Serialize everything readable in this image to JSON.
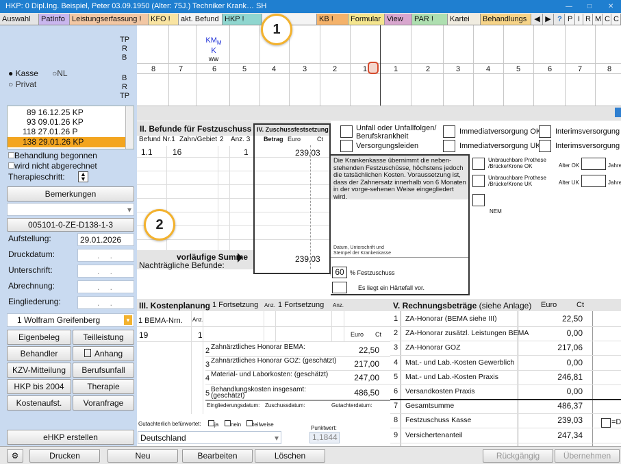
{
  "window": {
    "title": "HKP: 0  Dipl.Ing. Beispiel, Peter  03.09.1950 (Alter: 75J.)  Techniker Krank…  SH"
  },
  "tabs": [
    {
      "label": "Auswahl",
      "color": "#e4e4e4"
    },
    {
      "label": "PatInfo",
      "color": "#c9b6ee"
    },
    {
      "label": "Leistungserfassung !",
      "color": "#f2c7a4"
    },
    {
      "label": "KFO !",
      "color": "#f9e4a2"
    },
    {
      "label": "akt. Befund",
      "color": "#f4f4f4"
    },
    {
      "label": "HKP !",
      "color": "#8fd6cf"
    },
    {
      "label": "…bor",
      "color": "#f4f4f4"
    },
    {
      "label": "KB !",
      "color": "#f4b26a"
    },
    {
      "label": "Formular",
      "color": "#f4e58e"
    },
    {
      "label": "View",
      "color": "#d8a6ce"
    },
    {
      "label": "PAR !",
      "color": "#aedfb0"
    },
    {
      "label": "Kartei",
      "color": "#f0ece0"
    },
    {
      "label": "Behandlungs",
      "color": "#f6d488"
    },
    {
      "label": "P",
      "color": "#f4f4f4"
    },
    {
      "label": "I",
      "color": "#f4f4f4"
    },
    {
      "label": "R",
      "color": "#f4f4f4"
    },
    {
      "label": "M",
      "color": "#f4f4f4"
    },
    {
      "label": "C",
      "color": "#f4f4f4"
    },
    {
      "label": "C",
      "color": "#f4f4f4"
    }
  ],
  "left": {
    "tp_labels": [
      "TP",
      "R",
      "B"
    ],
    "kasse_label": "Kasse",
    "nl_label": "NL",
    "privat_label": "Privat",
    "br_labels": [
      "B",
      "R",
      "TP"
    ],
    "plans": [
      "89 16.12.25 KP",
      "93 09.01.26 KP",
      "118 27.01.26  P",
      "138 29.01.26 KP"
    ],
    "cb_begonnen": "Behandlung begonnen",
    "cb_abgerechnet": "wird nicht abgerechnet",
    "therapieschritt": "Therapieschritt:",
    "bemerkungen": "Bemerkungen",
    "plan_code": "005101-0-ZE-D138-1-3",
    "aufstellung_label": "Aufstellung:",
    "aufstellung_value": "29.01.2026",
    "druck_label": "Druckdatum:",
    "unterschrift_label": "Unterschrift:",
    "abrechnung_label": "Abrechnung:",
    "eingliederung_label": "Eingliederung:",
    "empty_date": ". .",
    "doctor": "1 Wolfram Greifenberg",
    "buttons": [
      "Eigenbeleg",
      "Teilleistung",
      "Behandler",
      "Anhang",
      "KZV-Mitteilung",
      "Berufsunfall",
      "HKP bis 2004",
      "Therapie",
      "Kostenaufst.",
      "Voranfrage"
    ],
    "ehkp": "eHKP erstellen"
  },
  "chart": {
    "kmk_label": "KM",
    "kmk_sub": "M",
    "k_label": "K",
    "ww_label": "ww",
    "teeth": [
      "8",
      "7",
      "6",
      "5",
      "4",
      "3",
      "2",
      "1",
      "1",
      "2",
      "3",
      "4",
      "5",
      "6",
      "7",
      "8"
    ]
  },
  "befunde": {
    "title": "II. Befunde für Festzuschuss",
    "col_nr": "Befund Nr.1",
    "col_zahn": "Zahn/Gebiet",
    "col_2": "2",
    "col_anz": "Anz. 3",
    "row_nr": "1.1",
    "row_zahn": "16",
    "row_anz": "1",
    "vorl_summe": "vorläufige Summe",
    "nachtraeglich": "Nachträgliche Befunde:"
  },
  "zuschuss": {
    "title": "IV. Zuschussfestsetzung",
    "betrag": "Betrag",
    "euro": "Euro",
    "ct": "Ct",
    "value": "239,03",
    "sum": "239,03"
  },
  "checkboxes": {
    "unfall": "Unfall oder Unfallfolgen/ Berufskrankheit",
    "versorgungsleiden": "Versorgungsleiden",
    "imm_ok": "Immediatversorgung OK",
    "imm_uk": "Immediatversorgung UK",
    "int_ok": "Interimsversorgung OK",
    "int_uk": "Interimsversorgung UK",
    "unbr_ok": "Unbrauchbare Prothese /Brücke/Krone OK",
    "unbr_uk": "Unbrauchbare Prothese /Brücke/Krone UK",
    "alter_ok": "Alter OK",
    "alter_uk": "Alter UK",
    "jahre": "Jahre",
    "nem": "NEM"
  },
  "kasse": {
    "text": "Die Krankenkasse übernimmt die neben-stehenden Festzuschüsse, höchstens jedoch die tatsächlichen Kosten. Voraussetzung ist, dass der Zahnersatz innerhalb von 6 Monaten in der vorge-sehenen Weise eingegliedert wird.",
    "stempel": "Datum, Unterschrift und Stempel der Krankenkasse",
    "percent": "60",
    "festzuschuss": "% Festzuschuss",
    "haertefall": "Es liegt ein Härtefall vor."
  },
  "kosten": {
    "title": "III. Kostenplanung",
    "fort1": "1 Fortsetzung",
    "anz": "Anz.",
    "fort2": "1 Fortsetzung",
    "bema_nr": "1 BEMA-Nrn.",
    "row_code": "19",
    "row_anz": "1",
    "euro": "Euro",
    "ct": "Ct",
    "rows": [
      {
        "n": "2",
        "label": "Zahnärztliches Honorar BEMA:",
        "value": "22,50"
      },
      {
        "n": "3",
        "label": "Zahnärztliches Honorar GOZ: (geschätzt)",
        "value": "217,00"
      },
      {
        "n": "4",
        "label": "Material- und Laborkosten: (geschätzt)",
        "value": "247,00"
      },
      {
        "n": "5",
        "label": "Behandlungskosten insgesamt: (geschätzt)",
        "value": "486,50"
      }
    ],
    "eingl": "Eingliederungsdatum:",
    "zusch": "Zuschussdatum:",
    "gutachterdatum": "Gutachterdatum:",
    "gutachterlich": "Gutachterlich befürwortet:",
    "ja": "ja",
    "nein": "nein",
    "teilweise": "teilweise",
    "punktwert_label": "Punktwert:",
    "punktwert": "1,1844",
    "country": "Deutschland"
  },
  "rechnung": {
    "title": "V. Rechnungsbeträge",
    "sub": "(siehe Anlage)",
    "euro": "Euro",
    "ct": "Ct",
    "rows": [
      {
        "n": "1",
        "label": "ZA-Honorar (BEMA siehe III)",
        "value": "22,50"
      },
      {
        "n": "2",
        "label": "ZA-Honorar zusätzl. Leistungen BEMA",
        "value": "0,00"
      },
      {
        "n": "3",
        "label": "ZA-Honorar GOZ",
        "value": "217,06"
      },
      {
        "n": "4",
        "label": "Mat.- und Lab.-Kosten Gewerblich",
        "value": "0,00"
      },
      {
        "n": "5",
        "label": "Mat.- und Lab.-Kosten Praxis",
        "value": "246,81"
      },
      {
        "n": "6",
        "label": "Versandkosten Praxis",
        "value": "0,00"
      },
      {
        "n": "7",
        "label": "Gesamtsumme",
        "value": "486,37"
      },
      {
        "n": "8",
        "label": "Festzuschuss Kasse",
        "value": "239,03"
      },
      {
        "n": "9",
        "label": "Versichertenanteil",
        "value": "247,34"
      }
    ],
    "eqd": "=D"
  },
  "toolbar": {
    "drucken": "Drucken",
    "neu": "Neu",
    "bearbeiten": "Bearbeiten",
    "loeschen": "Löschen",
    "rueckgaengig": "Rückgängig",
    "uebernehmen": "Übernehmen"
  },
  "callouts": [
    "1",
    "2"
  ]
}
